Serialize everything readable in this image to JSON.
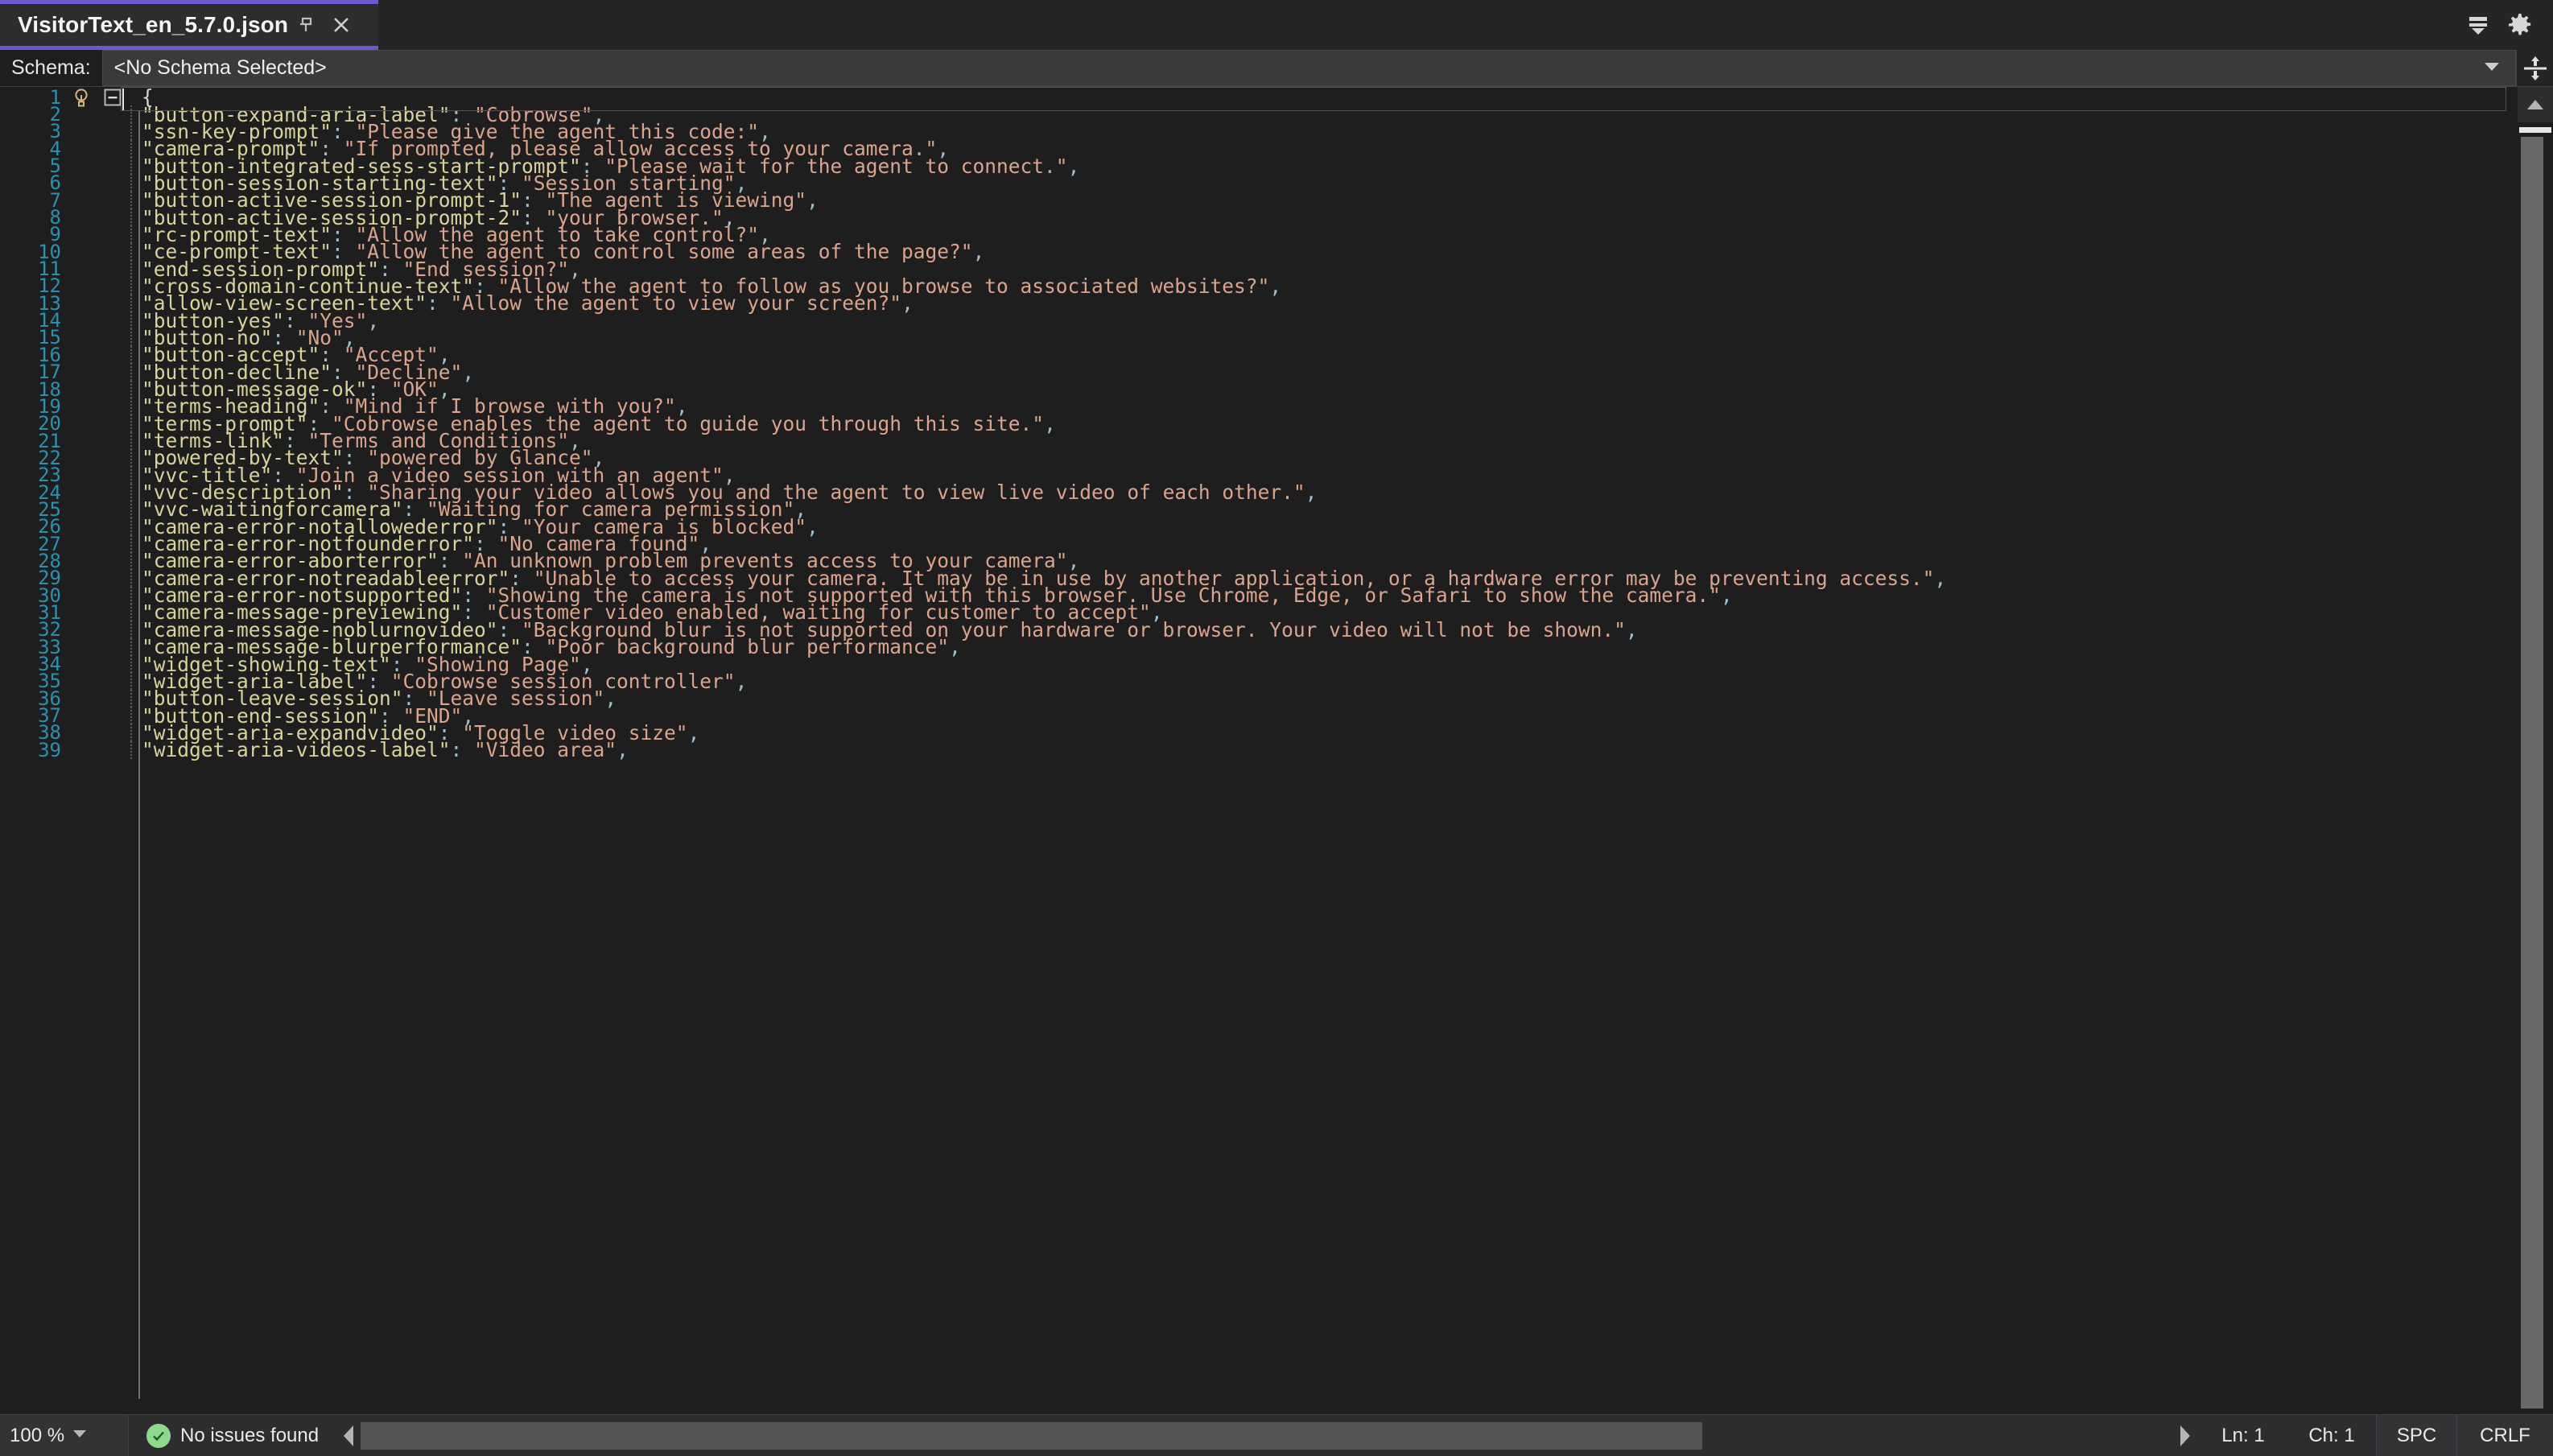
{
  "window": {
    "tab": {
      "title": "VisitorText_en_5.7.0.json",
      "pin_icon": "pin-icon",
      "close_icon": "close-icon"
    },
    "tabstrip_right": [
      {
        "icon": "collapse-down-icon"
      },
      {
        "icon": "gear-icon"
      }
    ],
    "accent_color": "#6a5acd"
  },
  "schema_bar": {
    "label": "Schema:",
    "value": "<No Schema Selected>",
    "dropdown_icon": "chevron-down-icon",
    "splitter_icon": "split-horizontal-icon"
  },
  "editor": {
    "language": "json",
    "cursor": {
      "line": 1,
      "column": 1
    },
    "key_color": "#d9d39b",
    "string_color": "#dba48c",
    "line_number_color": "#2b91af",
    "background": "#1e1e1e",
    "lightbulb_icon": "lightbulb-icon",
    "fold_icon": "collapse-minus-icon",
    "lines": [
      {
        "n": 1,
        "indent": 0,
        "raw": "{",
        "key": null,
        "value": null,
        "comma": false
      },
      {
        "n": 2,
        "indent": 1,
        "key": "button-expand-aria-label",
        "value": "Cobrowse",
        "comma": true
      },
      {
        "n": 3,
        "indent": 1,
        "key": "ssn-key-prompt",
        "value": "Please give the agent this code:",
        "comma": true
      },
      {
        "n": 4,
        "indent": 1,
        "key": "camera-prompt",
        "value": "If prompted, please allow access to your camera.",
        "comma": true
      },
      {
        "n": 5,
        "indent": 1,
        "key": "button-integrated-sess-start-prompt",
        "value": "Please wait for the agent to connect.",
        "comma": true
      },
      {
        "n": 6,
        "indent": 1,
        "key": "button-session-starting-text",
        "value": "Session starting",
        "comma": true
      },
      {
        "n": 7,
        "indent": 1,
        "key": "button-active-session-prompt-1",
        "value": "The agent is viewing",
        "comma": true
      },
      {
        "n": 8,
        "indent": 1,
        "key": "button-active-session-prompt-2",
        "value": "your browser.",
        "comma": true
      },
      {
        "n": 9,
        "indent": 1,
        "key": "rc-prompt-text",
        "value": "Allow the agent to take control?",
        "comma": true
      },
      {
        "n": 10,
        "indent": 1,
        "key": "ce-prompt-text",
        "value": "Allow the agent to control some areas of the page?",
        "comma": true
      },
      {
        "n": 11,
        "indent": 1,
        "key": "end-session-prompt",
        "value": "End session?",
        "comma": true
      },
      {
        "n": 12,
        "indent": 1,
        "key": "cross-domain-continue-text",
        "value": "Allow the agent to follow as you browse to associated websites?",
        "comma": true
      },
      {
        "n": 13,
        "indent": 1,
        "key": "allow-view-screen-text",
        "value": "Allow the agent to view your screen?",
        "comma": true
      },
      {
        "n": 14,
        "indent": 1,
        "key": "button-yes",
        "value": "Yes",
        "comma": true
      },
      {
        "n": 15,
        "indent": 1,
        "key": "button-no",
        "value": "No",
        "comma": true
      },
      {
        "n": 16,
        "indent": 1,
        "key": "button-accept",
        "value": "Accept",
        "comma": true
      },
      {
        "n": 17,
        "indent": 1,
        "key": "button-decline",
        "value": "Decline",
        "comma": true
      },
      {
        "n": 18,
        "indent": 1,
        "key": "button-message-ok",
        "value": "OK",
        "comma": true
      },
      {
        "n": 19,
        "indent": 1,
        "key": "terms-heading",
        "value": "Mind if I browse with you?",
        "comma": true
      },
      {
        "n": 20,
        "indent": 1,
        "key": "terms-prompt",
        "value": "Cobrowse enables the agent to guide you through this site.",
        "comma": true
      },
      {
        "n": 21,
        "indent": 1,
        "key": "terms-link",
        "value": "Terms and Conditions",
        "comma": true
      },
      {
        "n": 22,
        "indent": 1,
        "key": "powered-by-text",
        "value": "powered by Glance",
        "comma": true
      },
      {
        "n": 23,
        "indent": 1,
        "key": "vvc-title",
        "value": "Join a video session with an agent",
        "comma": true
      },
      {
        "n": 24,
        "indent": 1,
        "key": "vvc-description",
        "value": "Sharing your video allows you and the agent to view live video of each other.",
        "comma": true
      },
      {
        "n": 25,
        "indent": 1,
        "key": "vvc-waitingforcamera",
        "value": "Waiting for camera permission",
        "comma": true
      },
      {
        "n": 26,
        "indent": 1,
        "key": "camera-error-notallowederror",
        "value": "Your camera is blocked",
        "comma": true
      },
      {
        "n": 27,
        "indent": 1,
        "key": "camera-error-notfounderror",
        "value": "No camera found",
        "comma": true
      },
      {
        "n": 28,
        "indent": 1,
        "key": "camera-error-aborterror",
        "value": "An unknown problem prevents access to your camera",
        "comma": true
      },
      {
        "n": 29,
        "indent": 1,
        "key": "camera-error-notreadableerror",
        "value": "Unable to access your camera. It may be in use by another application, or a hardware error may be preventing access.",
        "comma": true
      },
      {
        "n": 30,
        "indent": 1,
        "key": "camera-error-notsupported",
        "value": "Showing the camera is not supported with this browser. Use Chrome, Edge, or Safari to show the camera.",
        "comma": true
      },
      {
        "n": 31,
        "indent": 1,
        "key": "camera-message-previewing",
        "value": "Customer video enabled, waiting for customer to accept",
        "comma": true
      },
      {
        "n": 32,
        "indent": 1,
        "key": "camera-message-noblurnovideo",
        "value": "Background blur is not supported on your hardware or browser. Your video will not be shown.",
        "comma": true
      },
      {
        "n": 33,
        "indent": 1,
        "key": "camera-message-blurperformance",
        "value": "Poor background blur performance",
        "comma": true
      },
      {
        "n": 34,
        "indent": 1,
        "key": "widget-showing-text",
        "value": "Showing Page",
        "comma": true
      },
      {
        "n": 35,
        "indent": 1,
        "key": "widget-aria-label",
        "value": "Cobrowse session controller",
        "comma": true
      },
      {
        "n": 36,
        "indent": 1,
        "key": "button-leave-session",
        "value": "Leave session",
        "comma": true
      },
      {
        "n": 37,
        "indent": 1,
        "key": "button-end-session",
        "value": "END",
        "comma": true
      },
      {
        "n": 38,
        "indent": 1,
        "key": "widget-aria-expandvideo",
        "value": "Toggle video size",
        "comma": true
      },
      {
        "n": 39,
        "indent": 1,
        "key": "widget-aria-videos-label",
        "value": "Video area",
        "comma": true
      }
    ]
  },
  "status_bar": {
    "zoom": "100 %",
    "zoom_dropdown_icon": "chevron-down-icon",
    "issues_icon": "check-circle-icon",
    "issues": "No issues found",
    "scroll_left_icon": "triangle-left-icon",
    "scroll_right_icon": "triangle-right-icon",
    "line": "Ln: 1",
    "column": "Ch: 1",
    "indentation": "SPC",
    "line_endings": "CRLF"
  }
}
